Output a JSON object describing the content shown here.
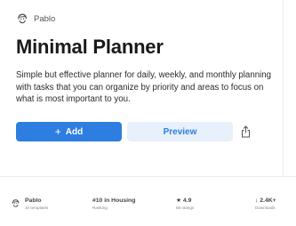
{
  "author": {
    "name": "Pablo",
    "avatar_icon": "person-sketch-avatar-icon"
  },
  "title": "Minimal Planner",
  "description": "Simple but effective planner for daily, weekly, and monthly planning with tasks that you can organize by priority and areas to focus on what is most important to you.",
  "actions": {
    "add_icon": "+",
    "add_label": "Add",
    "preview_label": "Preview",
    "share_icon": "share-icon"
  },
  "stats": {
    "author_name": "Pablo",
    "author_sub": "10 templates",
    "ranking_main": "#10 in Housing",
    "ranking_sub": "Ranking",
    "rating_main": "★ 4.9",
    "rating_sub": "58 ratings",
    "downloads_main": "↓ 2.4K+",
    "downloads_sub": "Downloads"
  },
  "colors": {
    "accent": "#2d7ee0",
    "accent_soft": "#e7f0fb"
  }
}
